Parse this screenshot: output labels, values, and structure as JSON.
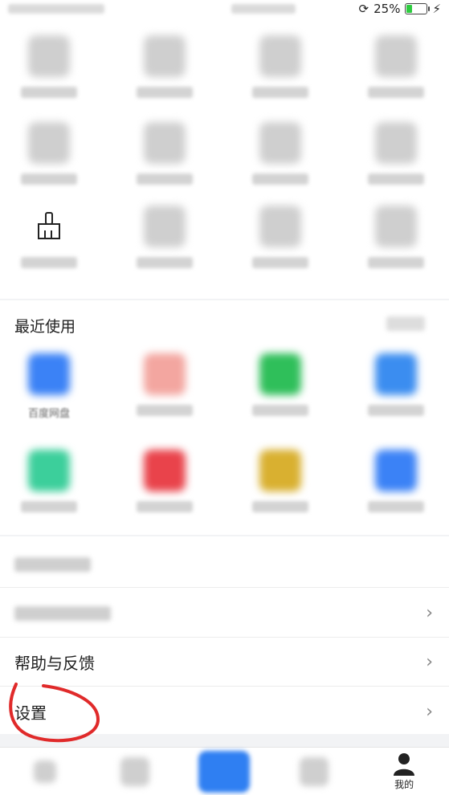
{
  "status": {
    "battery_percent": "25%",
    "battery_level": 0.25
  },
  "top_grid": {
    "tiles": [
      {
        "label": "",
        "color": "#cfcfcf"
      },
      {
        "label": "",
        "color": "#cfcfcf"
      },
      {
        "label": "",
        "color": "#cfcfcf"
      },
      {
        "label": "",
        "color": "#cfcfcf"
      },
      {
        "label": "",
        "color": "#cfcfcf"
      },
      {
        "label": "",
        "color": "#cfcfcf"
      },
      {
        "label": "",
        "color": "#cfcfcf"
      },
      {
        "label": "",
        "color": "#cfcfcf"
      },
      {
        "label": "",
        "icon": "broom-icon"
      },
      {
        "label": "",
        "color": "#cfcfcf"
      },
      {
        "label": "",
        "color": "#cfcfcf"
      },
      {
        "label": "",
        "color": "#cfcfcf"
      }
    ]
  },
  "recent": {
    "title": "最近使用",
    "tiles": [
      {
        "label": "百度网盘",
        "color": "#3b82f6"
      },
      {
        "label": "",
        "color": "#f3a6a0"
      },
      {
        "label": "",
        "color": "#2fbf5a"
      },
      {
        "label": "",
        "color": "#3b8df0"
      },
      {
        "label": "",
        "color": "#3ccf9b"
      },
      {
        "label": "",
        "color": "#e9434b"
      },
      {
        "label": "",
        "color": "#d9b030"
      },
      {
        "label": "",
        "color": "#3b82f6"
      }
    ]
  },
  "menu": {
    "help_label": "帮助与反馈",
    "settings_label": "设置",
    "chevron": "›"
  },
  "tabbar": {
    "mine_label": "我的"
  },
  "annotation": {
    "circle_color": "#e02a2a"
  }
}
